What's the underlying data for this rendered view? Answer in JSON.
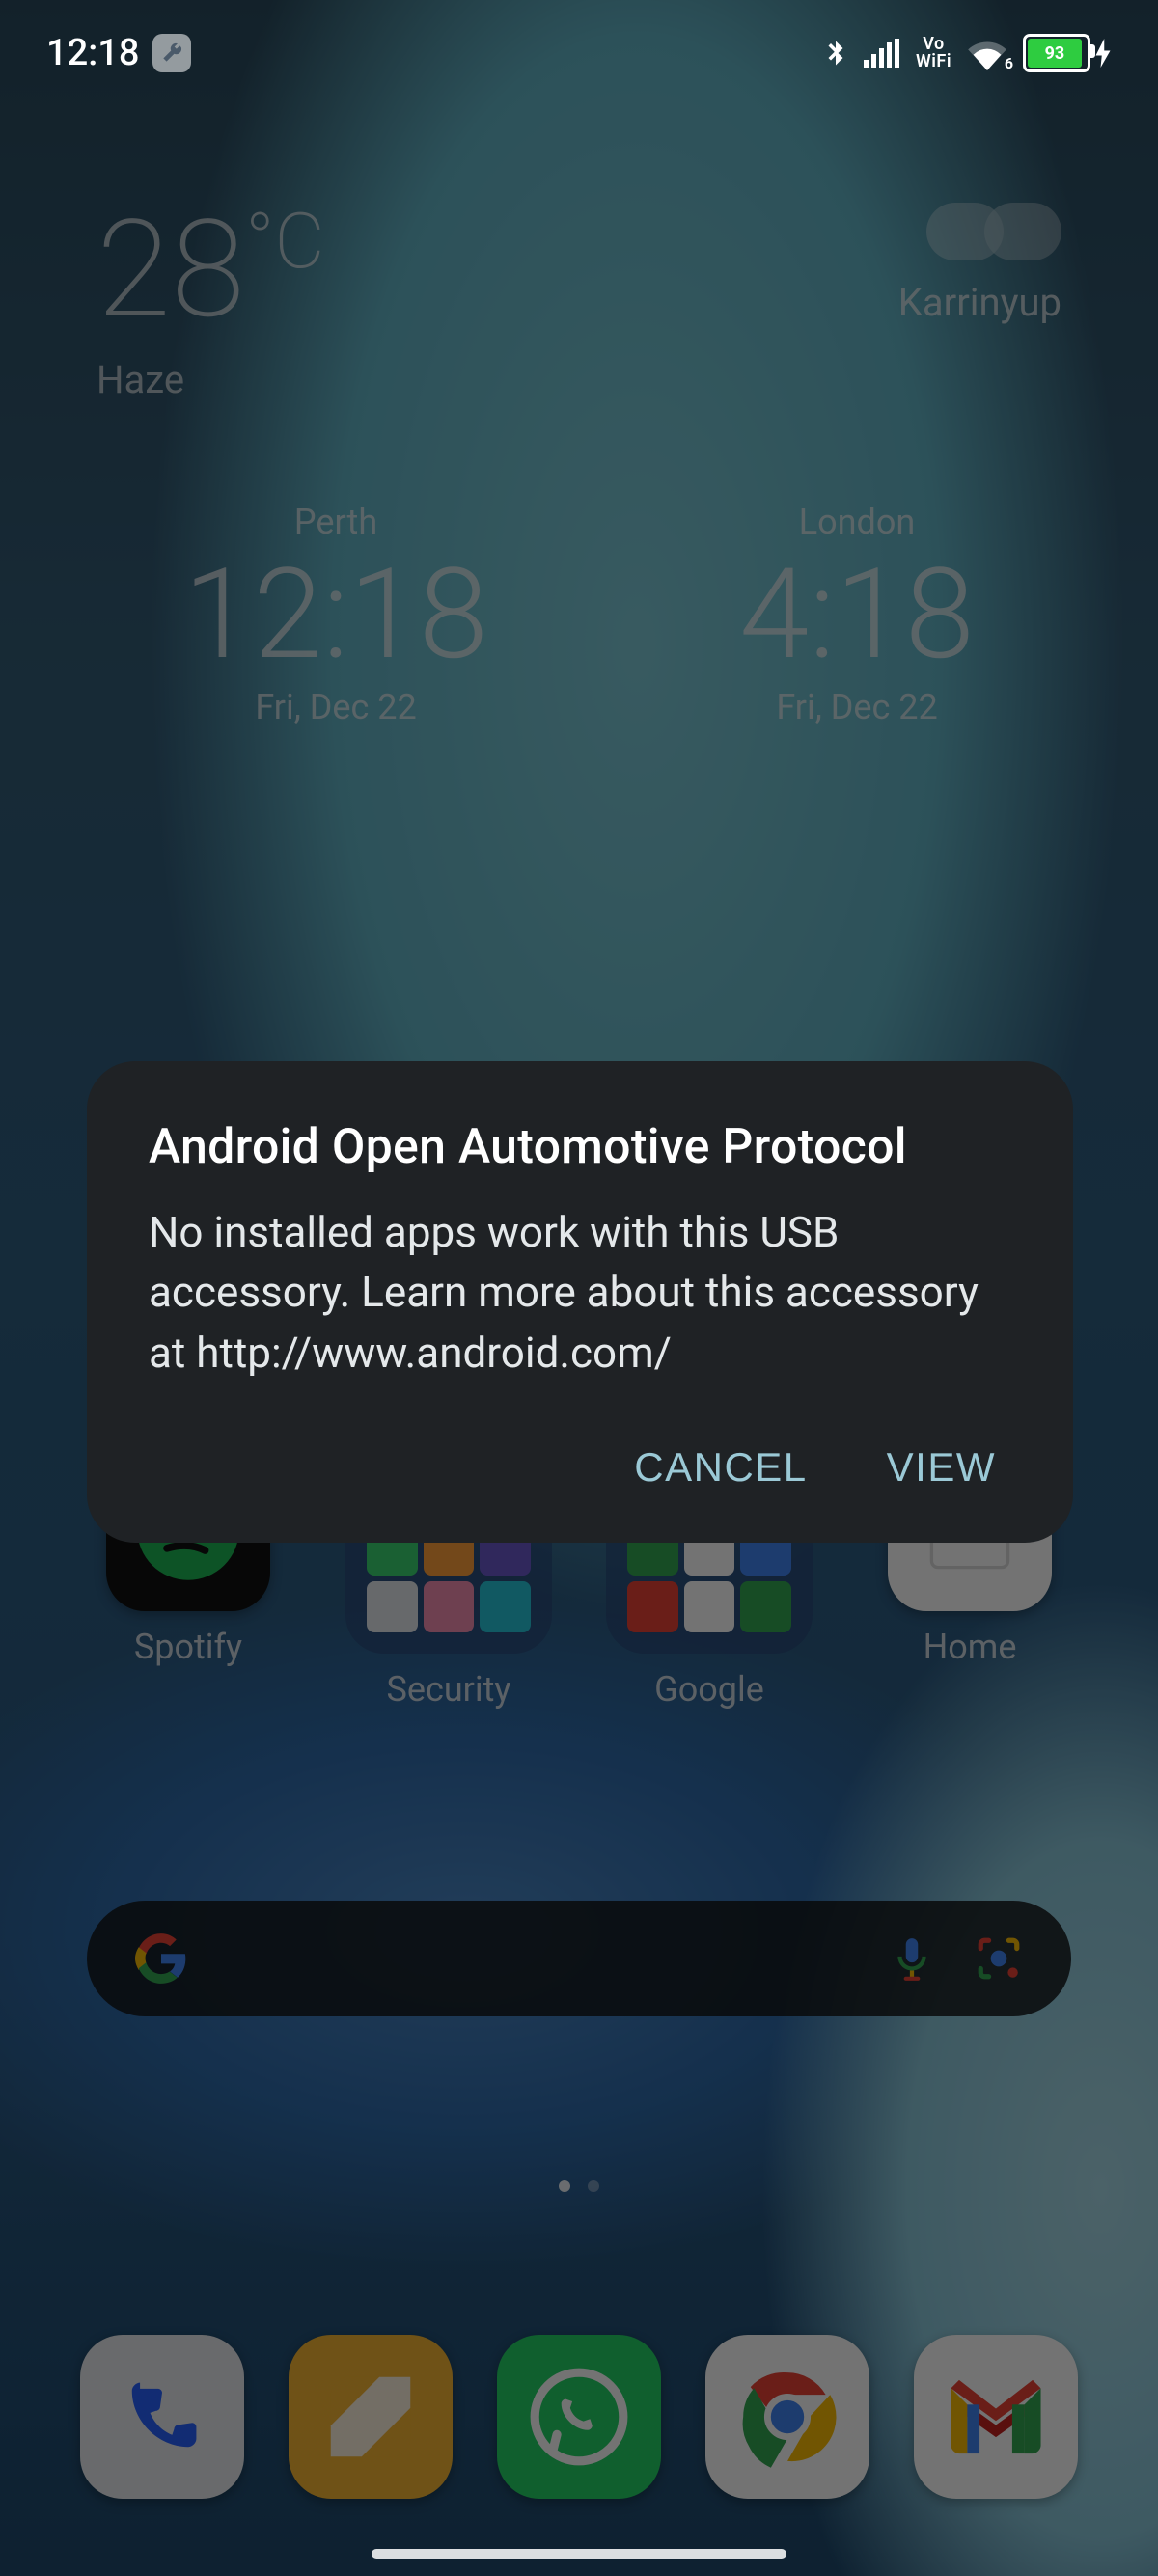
{
  "status": {
    "time": "12:18",
    "battery_pct": 93,
    "vowifi_top": "Vo",
    "vowifi_bottom": "WiFi",
    "wifi_badge": "6"
  },
  "weather": {
    "temp_value": "28",
    "temp_unit": "°C",
    "condition": "Haze",
    "location": "Karrinyup"
  },
  "clocks": [
    {
      "city": "Perth",
      "time": "12:18",
      "date": "Fri, Dec 22"
    },
    {
      "city": "London",
      "time": "4:18",
      "date": "Fri, Dec 22"
    }
  ],
  "app_row": [
    {
      "label": "Spotify"
    },
    {
      "label": "Security"
    },
    {
      "label": "Google"
    },
    {
      "label": "Home"
    }
  ],
  "dialog": {
    "title": "Android Open Automotive Protocol",
    "body": "No installed apps work with this USB accessory. Learn more about this accessory at http://www.android.com/",
    "cancel": "CANCEL",
    "view": "VIEW"
  }
}
